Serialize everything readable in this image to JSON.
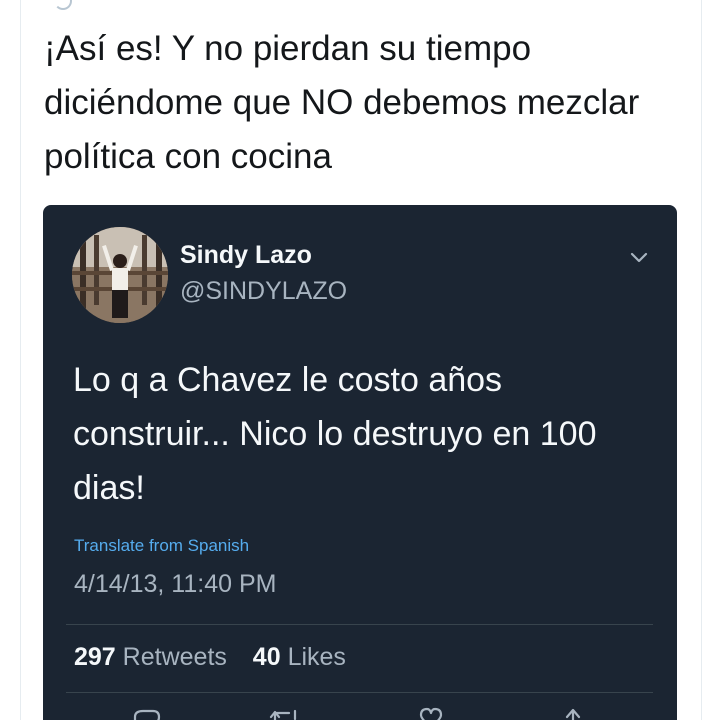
{
  "outer_tweet": {
    "text": "¡Así es! Y no pierdan su tiempo diciéndome que NO debemos mezclar política con cocina"
  },
  "quoted_tweet": {
    "author_name": "Sindy Lazo",
    "author_handle": "@SINDYLAZO",
    "text": "Lo q a Chavez le costo años construir... Nico lo destruyo en 100 dias!",
    "translate_label": "Translate from Spanish",
    "timestamp": "4/14/13, 11:40 PM",
    "retweet_count": "297",
    "retweets_label": "Retweets",
    "like_count": "40",
    "likes_label": "Likes"
  },
  "icons": {
    "menu": "chevron-down-icon",
    "actions": [
      "reply-icon",
      "retweet-icon",
      "like-icon",
      "share-icon"
    ]
  },
  "colors": {
    "card_background": "#1b2532",
    "link": "#55acee",
    "secondary_text": "#a8b4c0",
    "primary_text": "#f5f8fa"
  }
}
